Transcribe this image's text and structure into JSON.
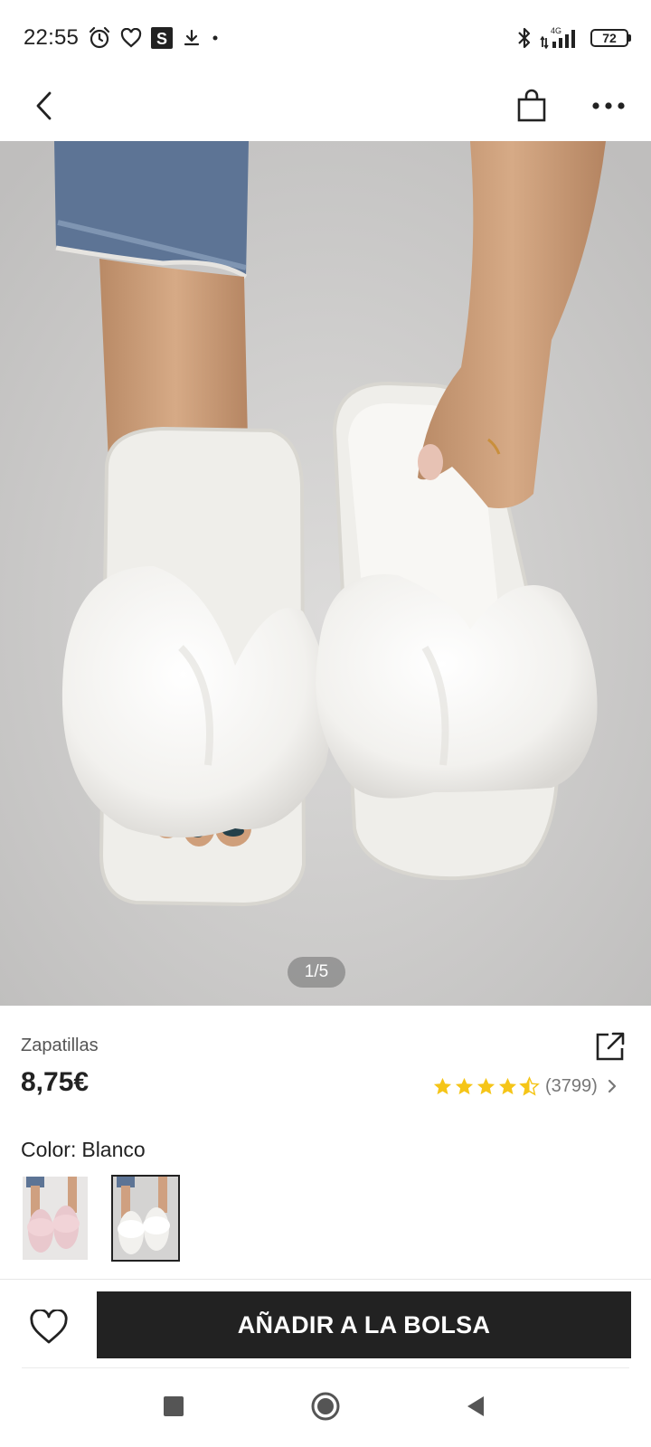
{
  "status_bar": {
    "time": "22:55",
    "network_label": "4G",
    "battery_level": "72",
    "icons": [
      "alarm-icon",
      "heart-outline-icon",
      "s-app-icon",
      "download-icon",
      "dot-icon",
      "bluetooth-icon",
      "signal-icon",
      "battery-icon"
    ]
  },
  "nav": {
    "icons": [
      "chevron-left-icon",
      "shopping-bag-icon",
      "more-horizontal-icon"
    ]
  },
  "gallery": {
    "counter": "1/5",
    "current_index": 1,
    "total": 5
  },
  "product": {
    "name": "Zapatillas",
    "price": "8,75€",
    "rating": 4.5,
    "review_count": "(3799)",
    "color_label": "Color:",
    "color_value": "Blanco",
    "swatches": [
      {
        "name": "pink",
        "selected": false
      },
      {
        "name": "white",
        "selected": true
      }
    ]
  },
  "actions": {
    "add_to_bag": "AÑADIR A LA BOLSA"
  },
  "colors": {
    "primary": "#222222",
    "star": "#f5c518",
    "gallery_bg": "#cfcecd",
    "secondary_text": "#777777"
  },
  "system_nav": {
    "icons": [
      "square-recents-icon",
      "circle-home-icon",
      "triangle-back-icon"
    ]
  }
}
